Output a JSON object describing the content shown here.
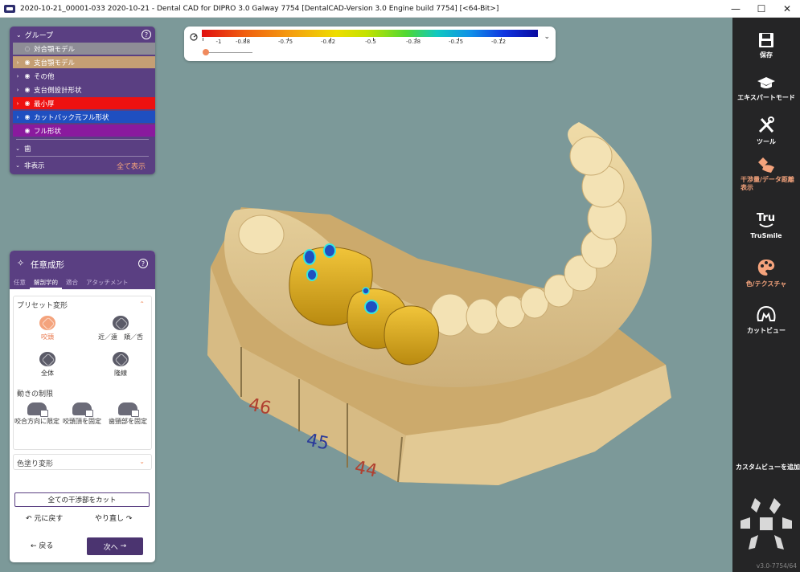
{
  "window": {
    "title": "2020-10-21_00001-033 2020-10-21 - Dental CAD for DIPRO 3.0 Galway 7754 [DentalCAD-Version 3.0 Engine build 7754] [<64-Bit>]",
    "minimize": "—",
    "maximize": "☐",
    "close": "✕"
  },
  "color_scale": {
    "labels": [
      "-1",
      "-0.88",
      "-0.75",
      "-0.62",
      "-0.5",
      "-0.38",
      "-0.25",
      "-0.12"
    ],
    "dropdown": "⌄",
    "gauge_icon": "gauge-icon"
  },
  "group_panel": {
    "title": "グループ",
    "help": "?",
    "rows": [
      {
        "label": "対合顎モデル",
        "color": "#8e8d96",
        "arrow": "",
        "eye": "hidden-eye"
      },
      {
        "label": "支台顎モデル",
        "color": "#c59f74",
        "arrow": "›",
        "eye": "eye"
      },
      {
        "label": "その他",
        "color": "#5a3f82",
        "arrow": "›",
        "eye": "eye"
      },
      {
        "label": "支台側設計形状",
        "color": "#5a3f82",
        "arrow": "›",
        "eye": "eye"
      },
      {
        "label": "最小厚",
        "color": "#ee1111",
        "arrow": "›",
        "eye": "eye"
      },
      {
        "label": "カットバック元フル形状",
        "color": "#1f4fc0",
        "arrow": "›",
        "eye": "eye"
      },
      {
        "label": "フル形状",
        "color": "#8a1a9e",
        "arrow": "",
        "eye": "eye"
      }
    ],
    "tooth_label": "歯",
    "hidden_label": "非表示",
    "show_all": "全て表示"
  },
  "form_panel": {
    "title": "任意成形",
    "help": "?",
    "tabs": [
      "任意",
      "解剖学的",
      "適合",
      "アタッチメント"
    ],
    "active_tab": 1,
    "preset_title": "プリセット変形",
    "presets": [
      {
        "label": "咬頭",
        "active": true
      },
      {
        "label": "近／遠　頬／舌",
        "active": false
      },
      {
        "label": "全体",
        "active": false
      },
      {
        "label": "隆線",
        "active": false
      }
    ],
    "limit_title": "動きの制限",
    "limits": [
      "咬合方向に限定",
      "咬頭頂を固定",
      "歯頸部を固定"
    ],
    "color_deform": "色塗り変形",
    "cut_all": "全ての干渉部をカット",
    "undo": "元に戻す",
    "redo": "やり直し",
    "back": "戻る",
    "next": "次へ"
  },
  "toolbar": {
    "items": [
      {
        "label": "保存",
        "icon": "save-icon",
        "accent": false
      },
      {
        "label": "エキスパートモード",
        "icon": "graduation-cap-icon",
        "accent": false
      },
      {
        "label": "ツール",
        "icon": "tools-icon",
        "accent": false
      },
      {
        "label": "干渉量/データ距離表示",
        "icon": "distance-display-icon",
        "accent": true
      },
      {
        "label": "TruSmile",
        "icon": "trusmile-icon",
        "accent": false
      },
      {
        "label": "色/テクスチャ",
        "icon": "palette-icon",
        "accent": true
      },
      {
        "label": "カットビュー",
        "icon": "cut-view-icon",
        "accent": false
      }
    ],
    "custom_view": "カスタムビューを追加",
    "version": "v3.0-7754/64"
  },
  "model": {
    "tooth_numbers": [
      "46",
      "45",
      "44"
    ]
  }
}
